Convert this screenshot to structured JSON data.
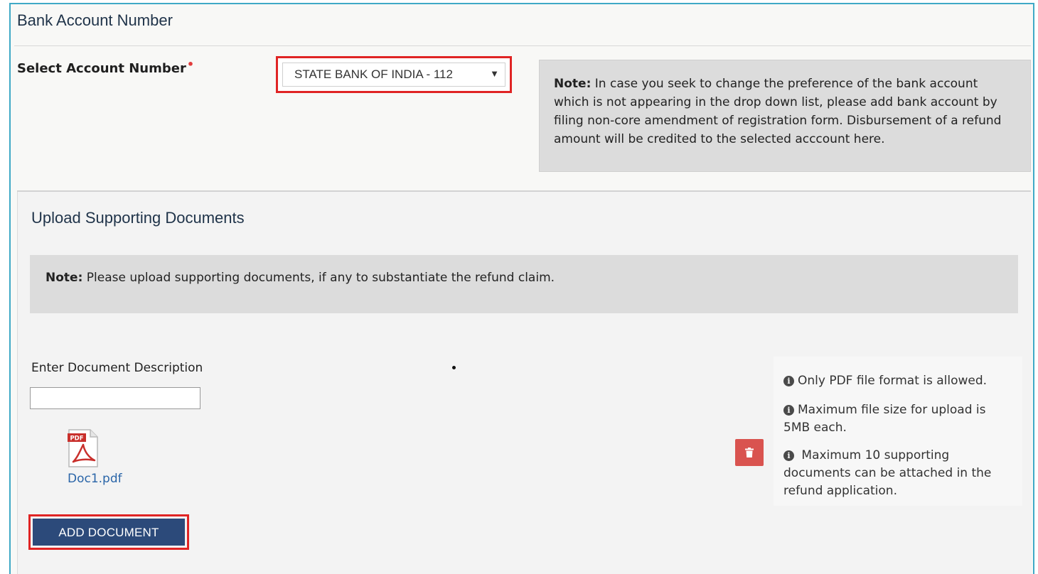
{
  "bank": {
    "section_title": "Bank Account Number",
    "select_label": "Select Account Number",
    "required_marker": "•",
    "selected_value": "STATE BANK OF INDIA - 112",
    "dropdown_arrow": "▼",
    "note_bold": "Note:",
    "note_text": " In case you seek to change the preference of the bank account which is not appearing in the drop down list, please add bank account by filing non-core amendment of registration form. Disbursement of a refund amount will be credited to the selected acccount here."
  },
  "upload": {
    "section_title": "Upload Supporting Documents",
    "note_bold": "Note:",
    "note_text": " Please upload supporting documents, if any to substantiate the refund claim.",
    "description_label": "Enter Document Description",
    "description_value": "",
    "uploaded_file": "Doc1.pdf",
    "pdf_icon_label": "PDF",
    "add_button": "ADD DOCUMENT",
    "info": [
      "Only PDF file format is allowed.",
      "Maximum file size for upload is 5MB each.",
      " Maximum 10 supporting documents can be attached in the refund application."
    ]
  },
  "icons": {
    "info": "info-circle-icon",
    "delete": "trash-icon",
    "pdf": "pdf-file-icon"
  },
  "colors": {
    "required": "#e23c3c",
    "highlight": "#e02424",
    "button": "#2c4a7a",
    "delete_button": "#d9534f",
    "link": "#2a65a8"
  }
}
